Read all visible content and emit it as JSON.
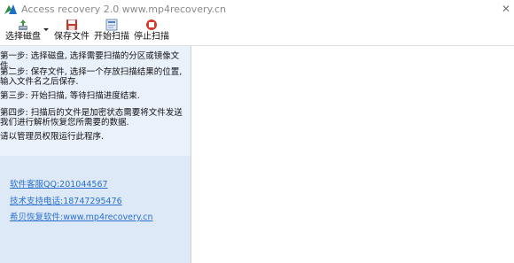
{
  "window": {
    "title": "Access recovery 2.0   www.mp4recovery.cn",
    "close_glyph": "✕"
  },
  "toolbar": {
    "select_disk": "选择磁盘",
    "save_file": "保存文件",
    "start_scan": "开始扫描",
    "stop_scan": "停止扫描"
  },
  "instructions": {
    "step1": "第一步: 选择磁盘, 选择需要扫描的分区或镜像文件.",
    "step2": "第二步: 保存文件, 选择一个存放扫描结果的位置, 输入文件名之后保存.",
    "step3": "第三步: 开始扫描, 等待扫描进度结束.",
    "step4": "第四步: 扫描后的文件是加密状态需要将文件发送我们进行解析恢复您所需要的数据.",
    "admin_note": "请以管理员权限运行此程序."
  },
  "links": {
    "qq": "软件客服QQ:201044567",
    "phone": "技术支持电话:18747295476",
    "site": "希贝恢复软件:www.mp4recovery.cn"
  },
  "colors": {
    "panel_bg": "#dde9f6",
    "link": "#2a6fcf"
  }
}
